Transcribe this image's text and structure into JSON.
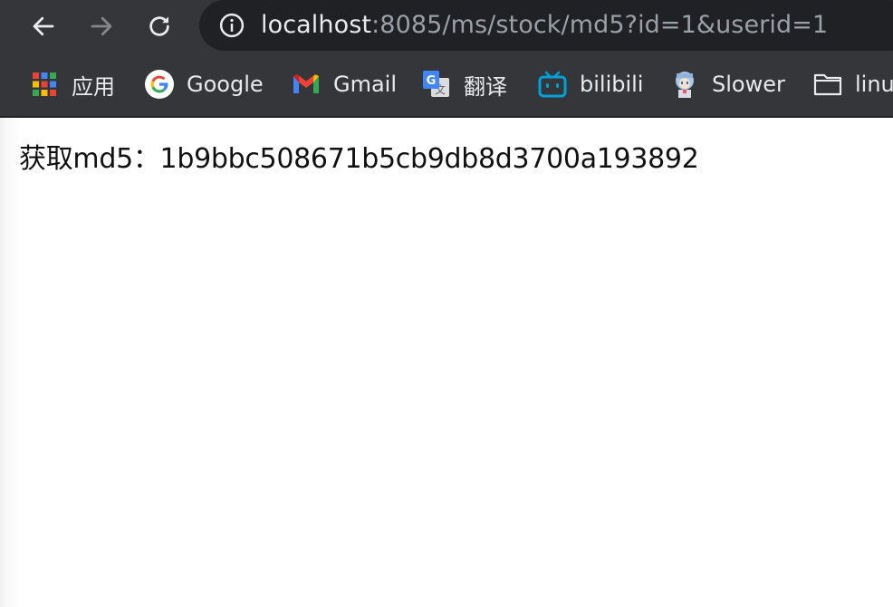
{
  "browser": {
    "url": {
      "host": "localhost",
      "path": ":8085/ms/stock/md5?id=1&userid=1"
    },
    "nav": {
      "back_icon": "arrow-left-icon",
      "forward_icon": "arrow-right-icon",
      "reload_icon": "reload-icon",
      "info_icon": "info-icon"
    },
    "bookmarks": [
      {
        "label": "应用",
        "icon": "apps-grid-icon"
      },
      {
        "label": "Google",
        "icon": "google-icon"
      },
      {
        "label": "Gmail",
        "icon": "gmail-icon"
      },
      {
        "label": "翻译",
        "icon": "google-translate-icon"
      },
      {
        "label": "bilibili",
        "icon": "bilibili-icon"
      },
      {
        "label": "Slower",
        "icon": "slower-avatar-icon"
      },
      {
        "label": "linu",
        "icon": "folder-icon"
      }
    ]
  },
  "page": {
    "text": "获取md5：1b9bbc508671b5cb9db8d3700a193892"
  },
  "colors": {
    "toolbar_bg": "#35363a",
    "omnibox_bg": "#202124",
    "url_host": "#e8eaed",
    "url_path": "#9aa0a6",
    "page_bg": "#ffffff",
    "text": "#111111"
  }
}
